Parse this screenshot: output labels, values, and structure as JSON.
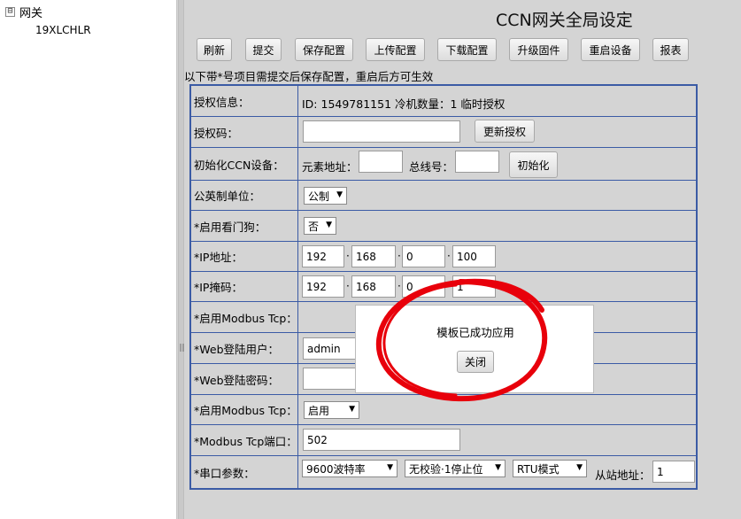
{
  "tree": {
    "toggle": "⊟",
    "root_label": "网关",
    "child_label": "19XLCHLR"
  },
  "page_title": "CCN网关全局设定",
  "toolbar": {
    "refresh": "刷新",
    "submit": "提交",
    "save_config": "保存配置",
    "upload_config": "上传配置",
    "download_config": "下载配置",
    "upgrade_firmware": "升级固件",
    "restart_device": "重启设备",
    "report": "报表"
  },
  "notice": "以下带*号项目需提交后保存配置，重启后方可生效",
  "form": {
    "auth_info": {
      "label": "授权信息：",
      "value": "ID: 1549781151 冷机数量：1 临时授权"
    },
    "auth_code": {
      "label": "授权码：",
      "value": "",
      "button": "更新授权"
    },
    "init_ccn": {
      "label": "初始化CCN设备：",
      "element_addr_label": "元素地址：",
      "element_addr": "",
      "bus_label": "总线号：",
      "bus": "",
      "button": "初始化"
    },
    "units": {
      "label": "公英制单位：",
      "selected": "公制"
    },
    "watchdog": {
      "label": "*启用看门狗：",
      "selected": "否"
    },
    "ip_address": {
      "label": "*IP地址：",
      "octets": [
        "192",
        "168",
        "0",
        "100"
      ]
    },
    "ip_mask": {
      "label": "*IP掩码：",
      "octets": [
        "192",
        "168",
        "0",
        "1"
      ]
    },
    "modbus_tcp_enable_1": {
      "label": "*启用Modbus Tcp："
    },
    "web_user": {
      "label": "*Web登陆用户：",
      "value": "admin"
    },
    "web_password": {
      "label": "*Web登陆密码：",
      "value": ""
    },
    "modbus_tcp_enable_2": {
      "label": "*启用Modbus Tcp：",
      "selected": "启用"
    },
    "modbus_port": {
      "label": "*Modbus Tcp端口：",
      "value": "502"
    },
    "serial": {
      "label": "*串口参数：",
      "baud": "9600波特率",
      "parity": "无校验·1停止位",
      "mode": "RTU模式",
      "slave_label": "从站地址：",
      "slave": "1"
    }
  },
  "modal": {
    "message": "模板已成功应用",
    "close_label": "关闭"
  },
  "colors": {
    "table_border": "#3b5ba5",
    "annotation": "#e8000b",
    "background": "#d4d4d4"
  }
}
